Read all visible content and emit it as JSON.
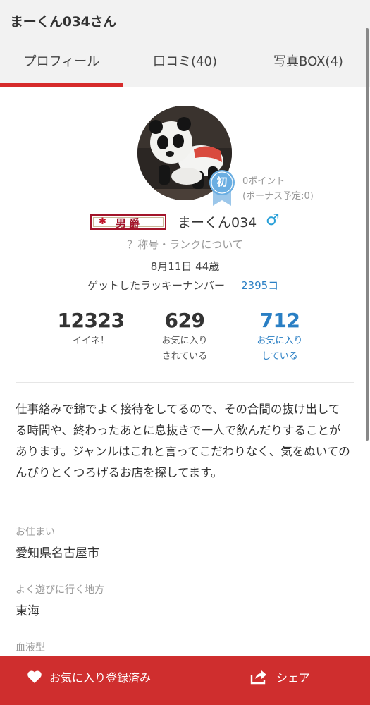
{
  "page": {
    "title": "まーくん034さん"
  },
  "tabs": [
    {
      "label": "プロフィール",
      "active": true
    },
    {
      "label": "口コミ(40)",
      "active": false
    },
    {
      "label": "写真BOX(4)",
      "active": false
    }
  ],
  "profile": {
    "badge": "初",
    "points": "0ポイント",
    "points_pending": "(ボーナス予定:0)",
    "rank": "男爵",
    "username": "まーくん034",
    "gender_icon": "♂",
    "rank_help": "？称号・ランクについて",
    "birthday": "8月11日 44歳",
    "lucky_label": "ゲットしたラッキーナンバー",
    "lucky_value": "2395コ"
  },
  "stats": [
    {
      "value": "12323",
      "label_line1": "イイネ！",
      "label_line2": ""
    },
    {
      "value": "629",
      "label_line1": "お気に入り",
      "label_line2": "されている"
    },
    {
      "value": "712",
      "label_line1": "お気に入り",
      "label_line2": "している"
    }
  ],
  "bio": "仕事絡みで錦でよく接待をしてるので、その合間の抜け出してる時間や、終わったあとに息抜きで一人で飲んだりすることがあります。ジャンルはこれと言ってこだわりなく、気をぬいてのんびりとくつろげるお店を探してます。",
  "info": {
    "residence_label": "お住まい",
    "residence_value": "愛知県名古屋市",
    "area_label": "よく遊びに行く地方",
    "area_value": "東海",
    "blood_label": "血液型"
  },
  "footer": {
    "favorite_label": "お気に入り登録済み",
    "share_label": "シェア"
  },
  "colors": {
    "accent": "#d62b2b",
    "footer": "#cf2e2e",
    "link": "#2a7fc4",
    "gender": "#29a0d8"
  },
  "icons": {
    "favorite": "heart-icon",
    "share": "share-icon",
    "gender": "male-icon",
    "badge": "beginner-ribbon-icon"
  }
}
